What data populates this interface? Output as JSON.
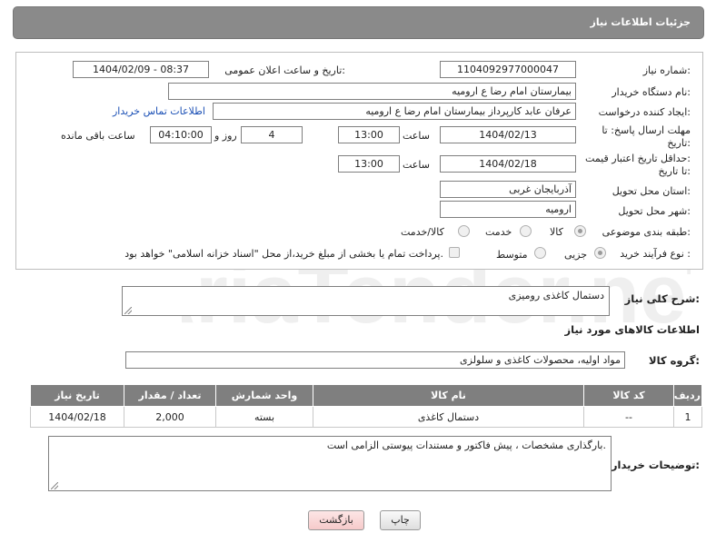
{
  "header": {
    "title": "جزئیات اطلاعات نیاز"
  },
  "fields": {
    "need_number_label": "شماره نیاز:",
    "need_number": "1104092977000047",
    "announce_label": "تاریخ و ساعت اعلان عمومی:",
    "announce_value": "1404/02/09 - 08:37",
    "buyer_label": "نام دستگاه خریدار:",
    "buyer_value": "بیمارستان امام رضا  ع  ارومیه",
    "creator_label": "ایجاد کننده درخواست:",
    "creator_value": "عرفان عابد کارپرداز بیمارستان امام رضا  ع  ارومیه",
    "contact_link": "اطلاعات تماس خریدار",
    "deadline_label_1": "مهلت ارسال پاسخ: تا",
    "deadline_label_2": "تاریخ:",
    "deadline_date": "1404/02/13",
    "time_label": "ساعت",
    "deadline_time": "13:00",
    "days_value": "4",
    "days_label": "روز و",
    "remaining_value": "04:10:00",
    "remaining_label": "ساعت باقی مانده",
    "min_price_label_1": "حداقل تاریخ اعتبار قیمت:",
    "min_price_label_2": "تا تاریخ:",
    "min_price_date": "1404/02/18",
    "min_price_time": "13:00",
    "province_label": "استان محل تحویل:",
    "province_value": "آذربایجان غربی",
    "city_label": "شهر محل تحویل:",
    "city_value": "ارومیه",
    "category_label": "طبقه بندی موضوعی:",
    "category_options": [
      "کالا",
      "خدمت",
      "کالا/خدمت"
    ],
    "process_label": "نوع فرآیند خرید :",
    "process_options": [
      "جزیی",
      "متوسط"
    ],
    "payment_note": "پرداخت تمام یا بخشی از مبلغ خرید،از محل \"اسناد خزانه اسلامی\" خواهد بود."
  },
  "description": {
    "label": "شرح کلی نیاز:",
    "value": "دستمال کاغذی رومیزی"
  },
  "goods_section": {
    "title": "اطلاعات کالاهای مورد نیاز",
    "group_label": "گروه کالا:",
    "group_value": "مواد اولیه، محصولات کاغذی و سلولزی"
  },
  "table": {
    "headers": [
      "ردیف",
      "کد کالا",
      "نام کالا",
      "واحد شمارش",
      "تعداد / مقدار",
      "تاریخ نیاز"
    ],
    "rows": [
      [
        "1",
        "--",
        "دستمال کاغذی",
        "بسته",
        "2,000",
        "1404/02/18"
      ]
    ]
  },
  "buyer_notes": {
    "label": "توضیحات خریدار:",
    "value": "بارگذاری مشخصات ، پیش فاکتور و مستندات پیوستی الزامی است."
  },
  "buttons": {
    "print": "چاپ",
    "back": "بازگشت"
  },
  "watermark_text": "AriaTender.neT",
  "colors": {
    "header_bg": "#8a8a8a",
    "link": "#1a4fb5",
    "back_button": "#f6caca"
  }
}
